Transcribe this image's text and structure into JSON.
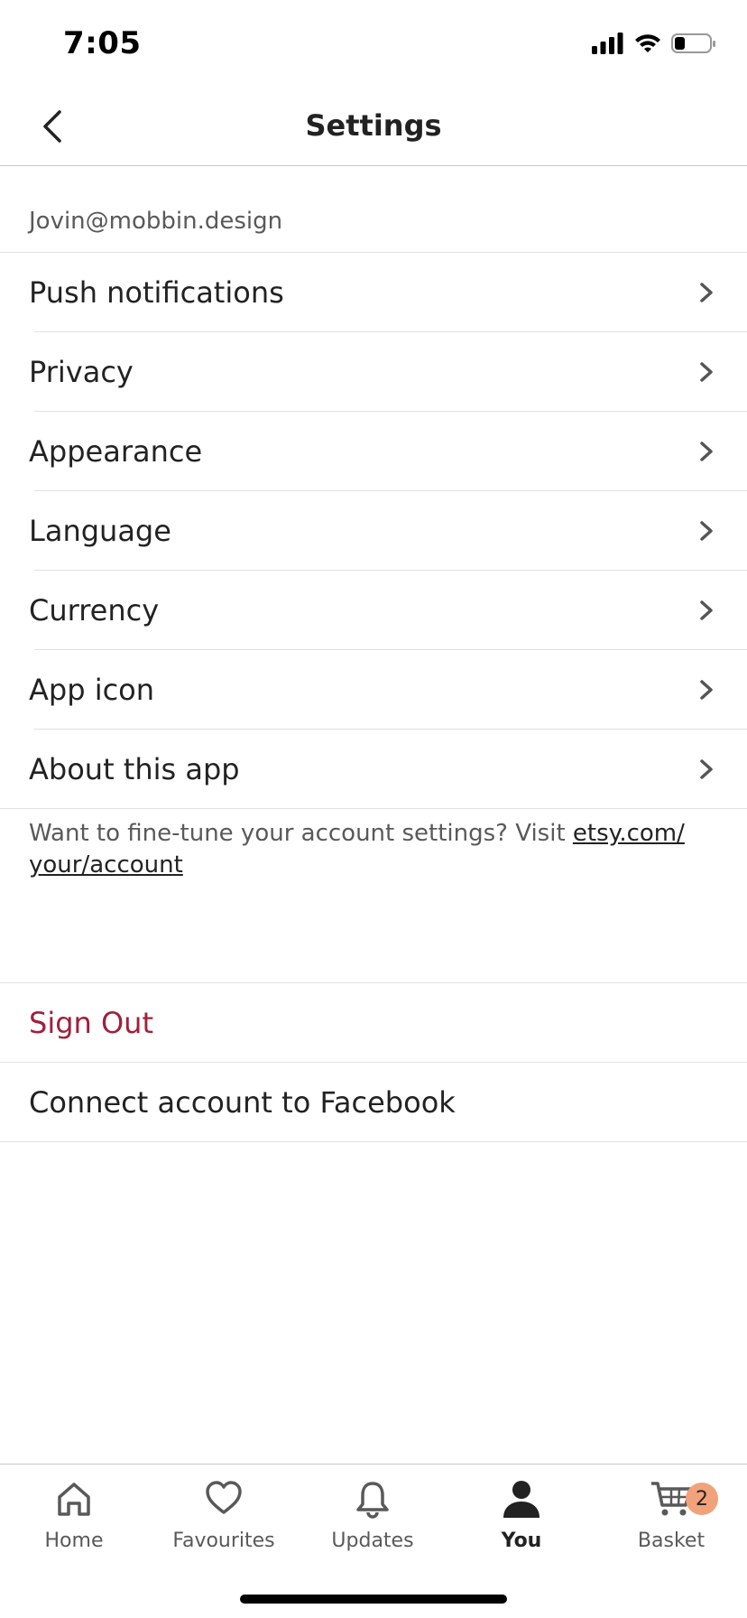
{
  "status_bar": {
    "time": "7:05"
  },
  "nav": {
    "title": "Settings"
  },
  "account": {
    "email": "Jovin@mobbin.design"
  },
  "settings_items": [
    {
      "label": "Push notifications"
    },
    {
      "label": "Privacy"
    },
    {
      "label": "Appearance"
    },
    {
      "label": "Language"
    },
    {
      "label": "Currency"
    },
    {
      "label": "App icon"
    },
    {
      "label": "About this app"
    }
  ],
  "hint": {
    "text": "Want to fine-tune your account settings? Visit ",
    "link": "etsy.com/ your/account"
  },
  "actions": {
    "sign_out": "Sign Out",
    "connect_facebook": "Connect account to Facebook"
  },
  "tabs": [
    {
      "label": "Home",
      "icon": "home-icon"
    },
    {
      "label": "Favourites",
      "icon": "heart-icon"
    },
    {
      "label": "Updates",
      "icon": "bell-icon"
    },
    {
      "label": "You",
      "icon": "person-icon",
      "active": true
    },
    {
      "label": "Basket",
      "icon": "cart-icon",
      "badge": "2"
    }
  ],
  "colors": {
    "sign_out": "#a0203c",
    "badge": "#f1a27a"
  }
}
